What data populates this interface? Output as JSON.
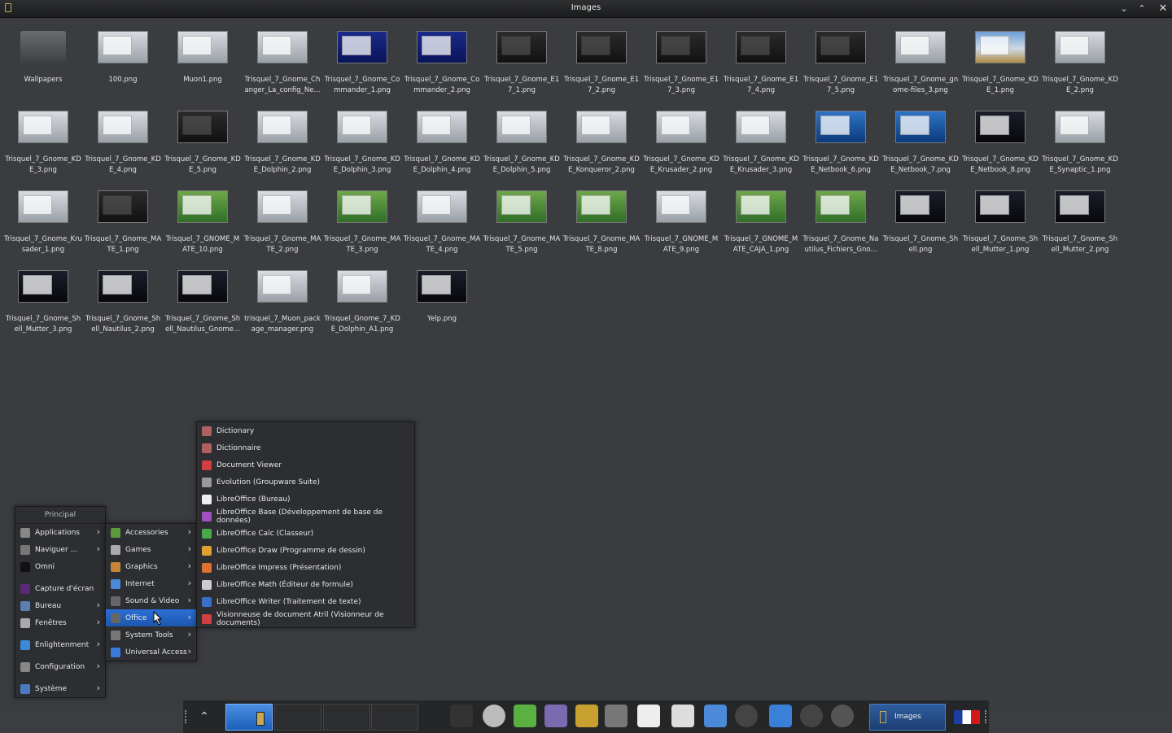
{
  "window": {
    "title": "Images",
    "buttons": [
      "minimize",
      "maximize",
      "close"
    ]
  },
  "files": [
    {
      "name": "Wallpapers",
      "kind": "folder"
    },
    {
      "name": "100.png",
      "kind": "light"
    },
    {
      "name": "Muon1.png",
      "kind": "light"
    },
    {
      "name": "Trisquel_7_Gnome_Changer_La_config_Ne...",
      "kind": "light"
    },
    {
      "name": "Trisquel_7_Gnome_Commander_1.png",
      "kind": "blue"
    },
    {
      "name": "Trisquel_7_Gnome_Commander_2.png",
      "kind": "blue"
    },
    {
      "name": "Trisquel_7_Gnome_E17_1.png",
      "kind": "dark"
    },
    {
      "name": "Trisquel_7_Gnome_E17_2.png",
      "kind": "dark"
    },
    {
      "name": "Trisquel_7_Gnome_E17_3.png",
      "kind": "dark"
    },
    {
      "name": "Trisquel_7_Gnome_E17_4.png",
      "kind": "dark"
    },
    {
      "name": "Trisquel_7_Gnome_E17_5.png",
      "kind": "dark"
    },
    {
      "name": "Trisquel_7_Gnome_gnome-files_3.png",
      "kind": "light"
    },
    {
      "name": "Trisquel_7_Gnome_KDE_1.png",
      "kind": "land"
    },
    {
      "name": "Trisquel_7_Gnome_KDE_2.png",
      "kind": "light"
    },
    {
      "name": "Trisquel_7_Gnome_KDE_3.png",
      "kind": "light"
    },
    {
      "name": "Trisquel_7_Gnome_KDE_4.png",
      "kind": "light"
    },
    {
      "name": "Trisquel_7_Gnome_KDE_5.png",
      "kind": "dark"
    },
    {
      "name": "Trisquel_7_Gnome_KDE_Dolphin_2.png",
      "kind": "light"
    },
    {
      "name": "Trisquel_7_Gnome_KDE_Dolphin_3.png",
      "kind": "light"
    },
    {
      "name": "Trisquel_7_Gnome_KDE_Dolphin_4.png",
      "kind": "light"
    },
    {
      "name": "Trisquel_7_Gnome_KDE_Dolphin_5.png",
      "kind": "light"
    },
    {
      "name": "Trisquel_7_Gnome_KDE_Konqueror_2.png",
      "kind": "light"
    },
    {
      "name": "Trisquel_7_Gnome_KDE_Krusader_2.png",
      "kind": "light"
    },
    {
      "name": "Trisquel_7_Gnome_KDE_Krusader_3.png",
      "kind": "light"
    },
    {
      "name": "Trisquel_7_Gnome_KDE_Netbook_6.png",
      "kind": "sky"
    },
    {
      "name": "Trisquel_7_Gnome_KDE_Netbook_7.png",
      "kind": "sky"
    },
    {
      "name": "Trisquel_7_Gnome_KDE_Netbook_8.png",
      "kind": "night"
    },
    {
      "name": "Trisquel_7_Gnome_KDE_Synaptic_1.png",
      "kind": "light"
    },
    {
      "name": "Trisquel_7_Gnome_Krusader_1.png",
      "kind": "light"
    },
    {
      "name": "Trisquel_7_Gnome_MATE_1.png",
      "kind": "dark"
    },
    {
      "name": "Trisquel_7_GNOME_MATE_10.png",
      "kind": "green"
    },
    {
      "name": "Trisquel_7_Gnome_MATE_2.png",
      "kind": "light"
    },
    {
      "name": "Trisquel_7_Gnome_MATE_3.png",
      "kind": "green"
    },
    {
      "name": "Trisquel_7_Gnome_MATE_4.png",
      "kind": "light"
    },
    {
      "name": "Trisquel_7_Gnome_MATE_5.png",
      "kind": "green"
    },
    {
      "name": "Trisquel_7_Gnome_MATE_8.png",
      "kind": "green"
    },
    {
      "name": "Trisquel_7_GNOME_MATE_9.png",
      "kind": "light"
    },
    {
      "name": "Trisquel_7_GNOME_MATE_CAJA_1.png",
      "kind": "green"
    },
    {
      "name": "Trisquel_7_Gnome_Nautilus_Fichiers_Gno...",
      "kind": "green"
    },
    {
      "name": "Trisquel_7_Gnome_Shell.png",
      "kind": "night"
    },
    {
      "name": "Trisquel_7_Gnome_Shell_Mutter_1.png",
      "kind": "night"
    },
    {
      "name": "Trisquel_7_Gnome_Shell_Mutter_2.png",
      "kind": "night"
    },
    {
      "name": "Trisquel_7_Gnome_Shell_Mutter_3.png",
      "kind": "night"
    },
    {
      "name": "Trisquel_7_Gnome_Shell_Nautilus_2.png",
      "kind": "night"
    },
    {
      "name": "Trisquel_7_Gnome_Shell_Nautilus_Gnome...",
      "kind": "night"
    },
    {
      "name": "trisquel_7_Muon_package_manager.png",
      "kind": "light"
    },
    {
      "name": "Trisquel_Gnome_7_KDE_Dolphin_A1.png",
      "kind": "light"
    },
    {
      "name": "Yelp.png",
      "kind": "night"
    }
  ],
  "main_menu": {
    "header": "Principal",
    "items": [
      {
        "label": "Applications",
        "submenu": true,
        "icon": "applications-icon",
        "color": "#888"
      },
      {
        "label": "Naviguer ...",
        "submenu": true,
        "icon": "folder-icon",
        "color": "#777"
      },
      {
        "label": "Omni",
        "submenu": false,
        "icon": "terminal-icon",
        "color": "#111"
      },
      {
        "sep": true
      },
      {
        "label": "Capture d'écran",
        "submenu": false,
        "icon": "camera-icon",
        "color": "#5a2a7a"
      },
      {
        "label": "Bureau",
        "submenu": true,
        "icon": "desktop-icon",
        "color": "#5b7fb0"
      },
      {
        "label": "Fenêtres",
        "submenu": true,
        "icon": "windows-icon",
        "color": "#aaa"
      },
      {
        "sep": true
      },
      {
        "label": "Enlightenment",
        "submenu": true,
        "icon": "enlightenment-icon",
        "color": "#3a8ad8"
      },
      {
        "sep": true
      },
      {
        "label": "Configuration",
        "submenu": true,
        "icon": "wrench-icon",
        "color": "#888"
      },
      {
        "sep": true
      },
      {
        "label": "Système",
        "submenu": true,
        "icon": "system-icon",
        "color": "#4a7ac0"
      }
    ]
  },
  "applications_menu": [
    {
      "label": "Accessories",
      "icon": "accessories-icon",
      "color": "#5a9a3a",
      "selected": false
    },
    {
      "label": "Games",
      "icon": "games-icon",
      "color": "#aaa",
      "selected": false
    },
    {
      "label": "Graphics",
      "icon": "graphics-icon",
      "color": "#c8853a",
      "selected": false
    },
    {
      "label": "Internet",
      "icon": "internet-icon",
      "color": "#4a8ad8",
      "selected": false
    },
    {
      "label": "Sound & Video",
      "icon": "sound-video-icon",
      "color": "#666",
      "selected": false
    },
    {
      "label": "Office",
      "icon": "office-icon",
      "color": "#666",
      "selected": true
    },
    {
      "label": "System Tools",
      "icon": "system-tools-icon",
      "color": "#777",
      "selected": false
    },
    {
      "label": "Universal Access",
      "icon": "accessibility-icon",
      "color": "#3a7ad8",
      "selected": false
    }
  ],
  "office_menu": [
    {
      "label": "Dictionary",
      "icon": "dictionary-icon",
      "color": "#b06060"
    },
    {
      "label": "Dictionnaire",
      "icon": "dictionary-icon",
      "color": "#b06060"
    },
    {
      "label": "Document Viewer",
      "icon": "document-viewer-icon",
      "color": "#d04040"
    },
    {
      "label": "Evolution (Groupware Suite)",
      "icon": "evolution-icon",
      "color": "#999"
    },
    {
      "label": "LibreOffice (Bureau)",
      "icon": "libreoffice-icon",
      "color": "#eee"
    },
    {
      "label": "LibreOffice Base (Développement de base de données)",
      "icon": "libreoffice-base-icon",
      "color": "#a050c0"
    },
    {
      "label": "LibreOffice Calc (Classeur)",
      "icon": "libreoffice-calc-icon",
      "color": "#4aa84a"
    },
    {
      "label": "LibreOffice Draw (Programme de dessin)",
      "icon": "libreoffice-draw-icon",
      "color": "#e0a030"
    },
    {
      "label": "LibreOffice Impress (Présentation)",
      "icon": "libreoffice-impress-icon",
      "color": "#e07030"
    },
    {
      "label": "LibreOffice Math (Éditeur de formule)",
      "icon": "libreoffice-math-icon",
      "color": "#ccc"
    },
    {
      "label": "LibreOffice Writer (Traitement de texte)",
      "icon": "libreoffice-writer-icon",
      "color": "#3a70c8"
    },
    {
      "label": "Visionneuse de document Atril (Visionneur de documents)",
      "icon": "atril-icon",
      "color": "#d04040"
    }
  ],
  "taskbar": {
    "launchers": [
      {
        "name": "terminal-icon",
        "color": "#333"
      },
      {
        "name": "clock-icon",
        "color": "#bbb"
      },
      {
        "name": "leaf-icon",
        "color": "#5ab040"
      },
      {
        "name": "pidgin-icon",
        "color": "#7a6ab0"
      },
      {
        "name": "speaker-icon",
        "color": "#c8a030"
      },
      {
        "name": "gimp-icon",
        "color": "#777"
      },
      {
        "name": "document-icon",
        "color": "#eee"
      },
      {
        "name": "bulb-icon",
        "color": "#ddd"
      },
      {
        "name": "thermometer-icon",
        "color": "#4a8ad8"
      },
      {
        "name": "gauge-icon",
        "color": "#444"
      },
      {
        "name": "clipboard-icon",
        "color": "#3a80d8"
      },
      {
        "name": "compass-icon",
        "color": "#444"
      },
      {
        "name": "mixer-icon",
        "color": "#555"
      }
    ],
    "task": {
      "label": "Images"
    },
    "flag": {
      "name": "france-flag-icon"
    }
  }
}
